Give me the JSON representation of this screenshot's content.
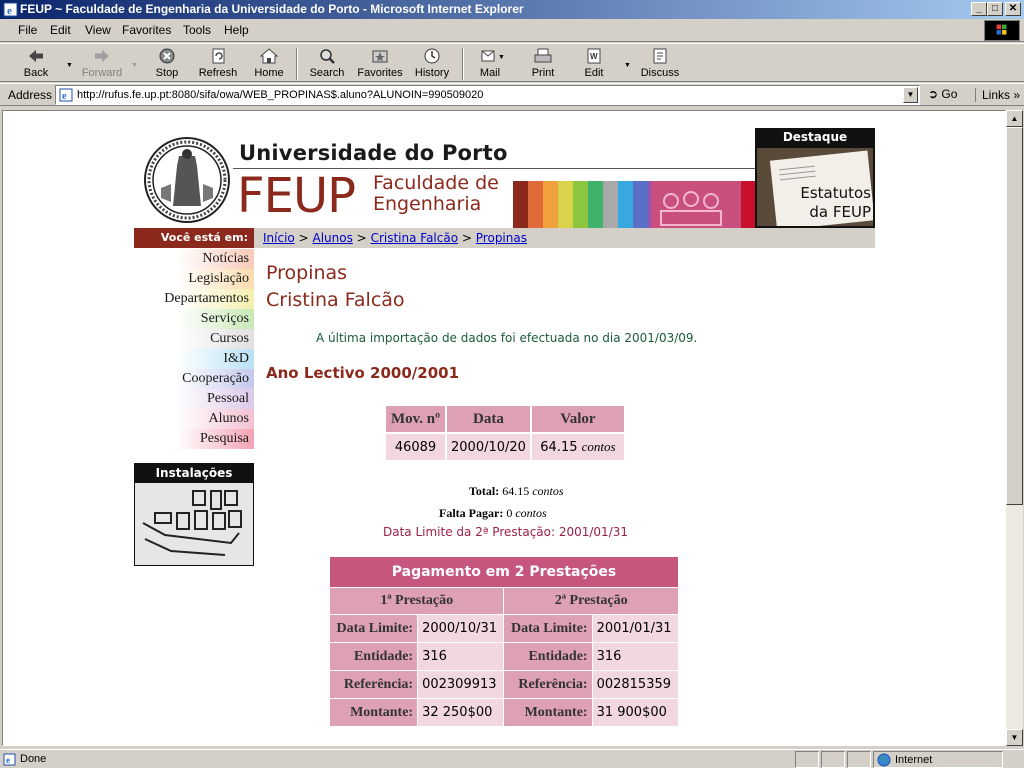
{
  "window": {
    "title": "FEUP ~ Faculdade de Engenharia da Universidade do Porto - Microsoft Internet Explorer"
  },
  "menubar": {
    "items": [
      "File",
      "Edit",
      "View",
      "Favorites",
      "Tools",
      "Help"
    ]
  },
  "toolbar": {
    "back": "Back",
    "forward": "Forward",
    "stop": "Stop",
    "refresh": "Refresh",
    "home": "Home",
    "search": "Search",
    "favorites": "Favorites",
    "history": "History",
    "mail": "Mail",
    "print": "Print",
    "edit": "Edit",
    "discuss": "Discuss"
  },
  "addressbar": {
    "label": "Address",
    "url": "http://rufus.fe.up.pt:8080/sifa/owa/WEB_PROPINAS$.aluno?ALUNOIN=990509020",
    "go": "Go",
    "links": "Links"
  },
  "header": {
    "university": "Universidade do Porto",
    "feup": "FEUP",
    "faculty_line1": "Faculdade de",
    "faculty_line2": "Engenharia",
    "destaque_title": "Destaque",
    "destaque_line1": "Estatutos",
    "destaque_line2": "da FEUP",
    "strip_colors": [
      "#8b2a1c",
      "#e06a3a",
      "#f0a03c",
      "#d9d24a",
      "#8cc63e",
      "#3fb36b",
      "#a9a9a9",
      "#38a8e0",
      "#5a6fc7",
      "#8a5ab5"
    ]
  },
  "breadcrumb": {
    "label": "Você está em:",
    "items": [
      "Início",
      "Alunos",
      "Cristina Falcão",
      "Propinas"
    ],
    "separator": ">"
  },
  "leftnav": {
    "items": [
      {
        "label": "Notícias",
        "color": "#f7c9b8"
      },
      {
        "label": "Legislação",
        "color": "#f9dcae"
      },
      {
        "label": "Departamentos",
        "color": "#f4f0b0"
      },
      {
        "label": "Serviços",
        "color": "#c7e8b5"
      },
      {
        "label": "Cursos",
        "color": "#e0e0e0"
      },
      {
        "label": "I&D",
        "color": "#b9e1f4"
      },
      {
        "label": "Cooperação",
        "color": "#c2c9ec"
      },
      {
        "label": "Pessoal",
        "color": "#dcc9ea"
      },
      {
        "label": "Alunos",
        "color": "#f3c1d2"
      },
      {
        "label": "Pesquisa",
        "color": "#f2a3b4"
      }
    ],
    "instalacoes": "Instalações"
  },
  "main": {
    "title": "Propinas",
    "student": "Cristina Falcão",
    "import_note": "A última importação de dados foi efectuada no dia 2001/03/09.",
    "year": "Ano Lectivo 2000/2001",
    "mov_table": {
      "headers": [
        "Mov. nº",
        "Data",
        "Valor"
      ],
      "rows": [
        {
          "mov": "46089",
          "data": "2000/10/20",
          "valor": "64.15",
          "unit": "contos"
        }
      ]
    },
    "total_label": "Total:",
    "total_value": "64.15",
    "total_unit": "contos",
    "falta_label": "Falta Pagar:",
    "falta_value": "0",
    "falta_unit": "contos",
    "limite2": "Data Limite da 2ª Prestação: 2001/01/31",
    "prest_table": {
      "title": "Pagamento em 2 Prestações",
      "col1": "1ª Prestação",
      "col2": "2ª Prestação",
      "rows": [
        {
          "k1": "Data Limite:",
          "v1": "2000/10/31",
          "k2": "Data Limite:",
          "v2": "2001/01/31"
        },
        {
          "k1": "Entidade:",
          "v1": "316",
          "k2": "Entidade:",
          "v2": "316"
        },
        {
          "k1": "Referência:",
          "v1": "002309913",
          "k2": "Referência:",
          "v2": "002815359"
        },
        {
          "k1": "Montante:",
          "v1": "32 250$00",
          "k2": "Montante:",
          "v2": "31 900$00"
        }
      ]
    }
  },
  "statusbar": {
    "text": "Done",
    "zone": "Internet"
  }
}
